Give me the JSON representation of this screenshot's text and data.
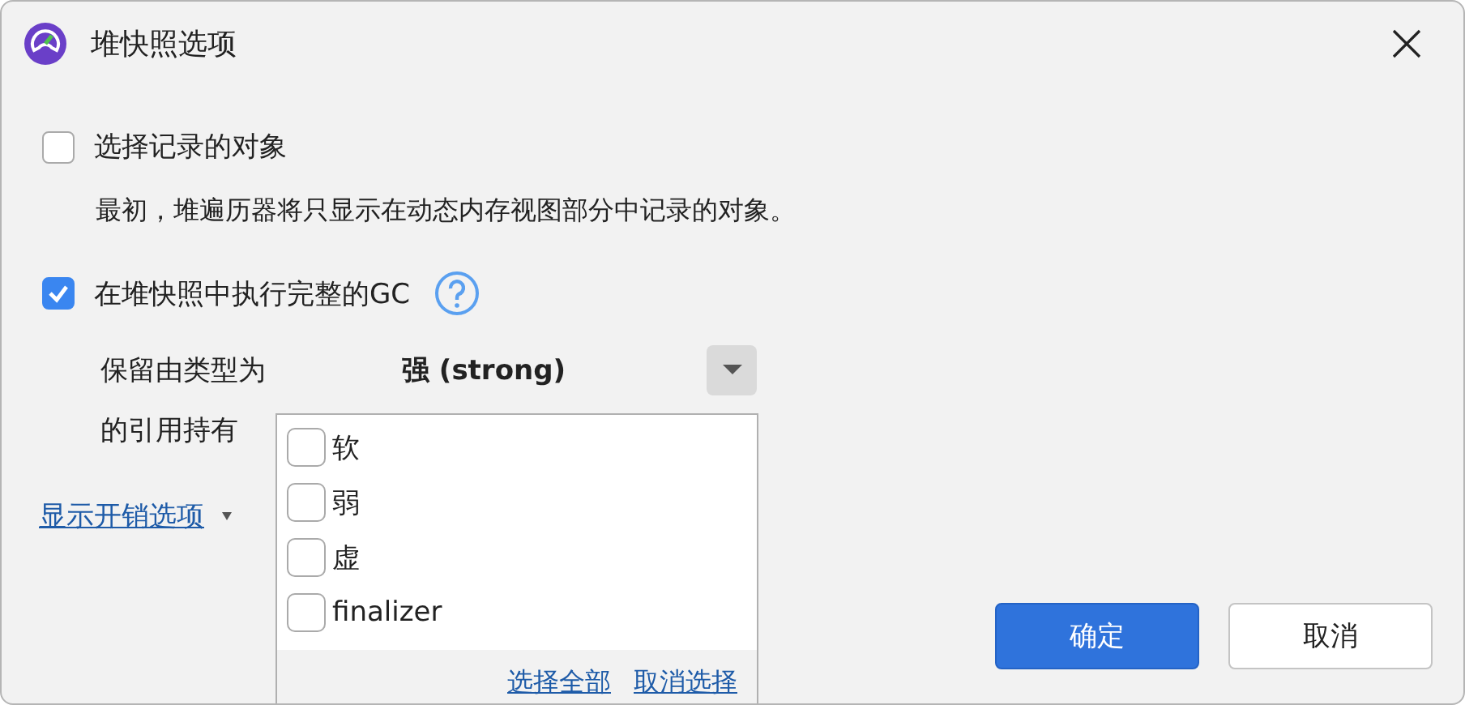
{
  "window": {
    "title": "堆快照选项"
  },
  "select_recorded": {
    "label": "选择记录的对象",
    "checked": false,
    "description": "最初，堆遍历器将只显示在动态内存视图部分中记录的对象。"
  },
  "full_gc": {
    "label": "在堆快照中执行完整的GC",
    "checked": true
  },
  "retain": {
    "label_line_1": "保留由类型为",
    "label_line_2": "的引用持有",
    "value": "强 (strong)"
  },
  "overhead_link": "显示开销选项",
  "popup": {
    "options": [
      {
        "label": "软",
        "checked": false
      },
      {
        "label": "弱",
        "checked": false
      },
      {
        "label": "虚",
        "checked": false
      },
      {
        "label": "finalizer",
        "checked": false
      }
    ],
    "links": [
      "选择全部",
      "取消选择"
    ]
  },
  "buttons": [
    {
      "label": "确定",
      "kind": "primary"
    },
    {
      "label": "取消",
      "kind": "secondary"
    }
  ]
}
